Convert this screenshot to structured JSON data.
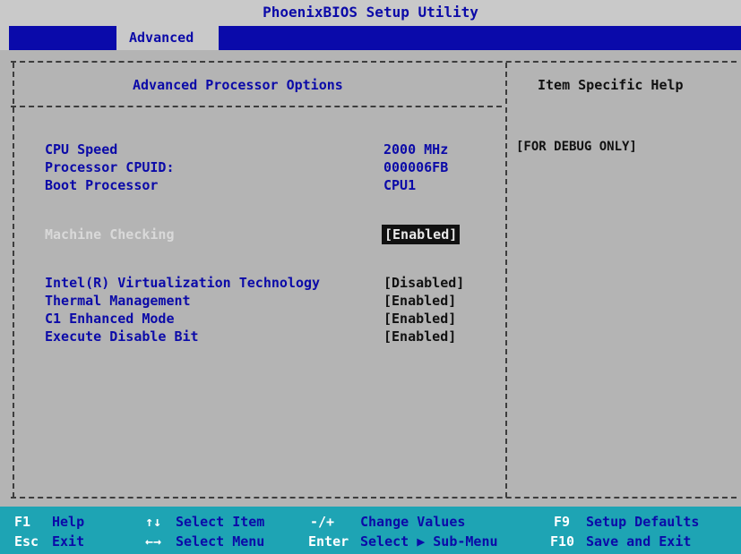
{
  "title": "PhoenixBIOS Setup Utility",
  "menu": {
    "active_tab": "Advanced"
  },
  "main_panel": {
    "title": "Advanced Processor Options",
    "info_rows": [
      {
        "label": "CPU Speed",
        "value": "2000 MHz"
      },
      {
        "label": "Processor CPUID:",
        "value": "000006FB"
      },
      {
        "label": "Boot Processor",
        "value": "CPU1"
      }
    ],
    "focused_item": {
      "label": "Machine Checking",
      "value": "[Enabled]"
    },
    "options": [
      {
        "label": "Intel(R) Virtualization Technology",
        "value": "[Disabled]"
      },
      {
        "label": "Thermal Management",
        "value": "[Enabled]"
      },
      {
        "label": "C1 Enhanced Mode",
        "value": "[Enabled]"
      },
      {
        "label": "Execute Disable Bit",
        "value": "[Enabled]"
      }
    ]
  },
  "help_panel": {
    "title": "Item Specific Help",
    "text": "[FOR DEBUG ONLY]"
  },
  "footer": {
    "row1": [
      {
        "key": "F1",
        "action": "Help"
      },
      {
        "key": "↑↓",
        "action": "Select Item"
      },
      {
        "key": "-/+",
        "action": "Change Values"
      },
      {
        "key": "F9",
        "action": "Setup Defaults"
      }
    ],
    "row2": [
      {
        "key": "Esc",
        "action": "Exit"
      },
      {
        "key": "←→",
        "action": "Select Menu"
      },
      {
        "key": "Enter",
        "action": "Select ▶ Sub-Menu"
      },
      {
        "key": "F10",
        "action": "Save and Exit"
      }
    ]
  },
  "colors": {
    "background": "#b4b4b4",
    "accent_blue": "#0a0aaa",
    "footer": "#1ea4b4"
  }
}
